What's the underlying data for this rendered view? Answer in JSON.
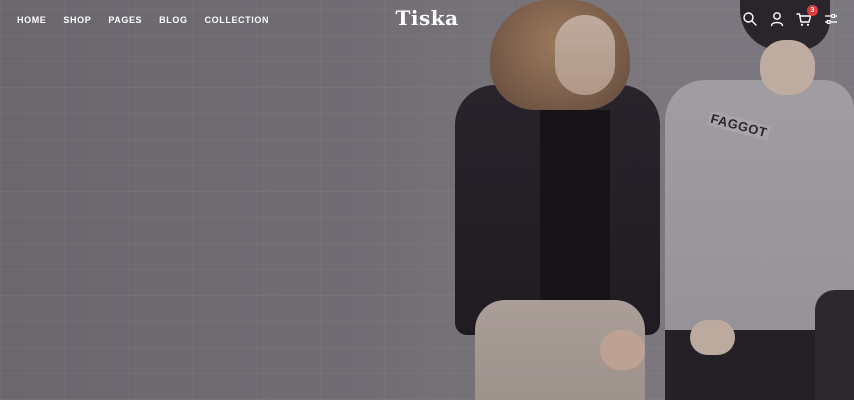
{
  "nav": {
    "items": [
      "HOME",
      "SHOP",
      "PAGES",
      "BLOG",
      "COLLECTION"
    ]
  },
  "brand": {
    "logo_text": "Tiska"
  },
  "header_icons": {
    "search": "search-icon",
    "account": "user-icon",
    "cart": "cart-icon",
    "cart_count": "3",
    "settings": "sliders-icon"
  },
  "hero": {
    "shirt_print": "FAGGOT"
  },
  "colors": {
    "text": "#ffffff",
    "badge": "#e23b3b"
  }
}
